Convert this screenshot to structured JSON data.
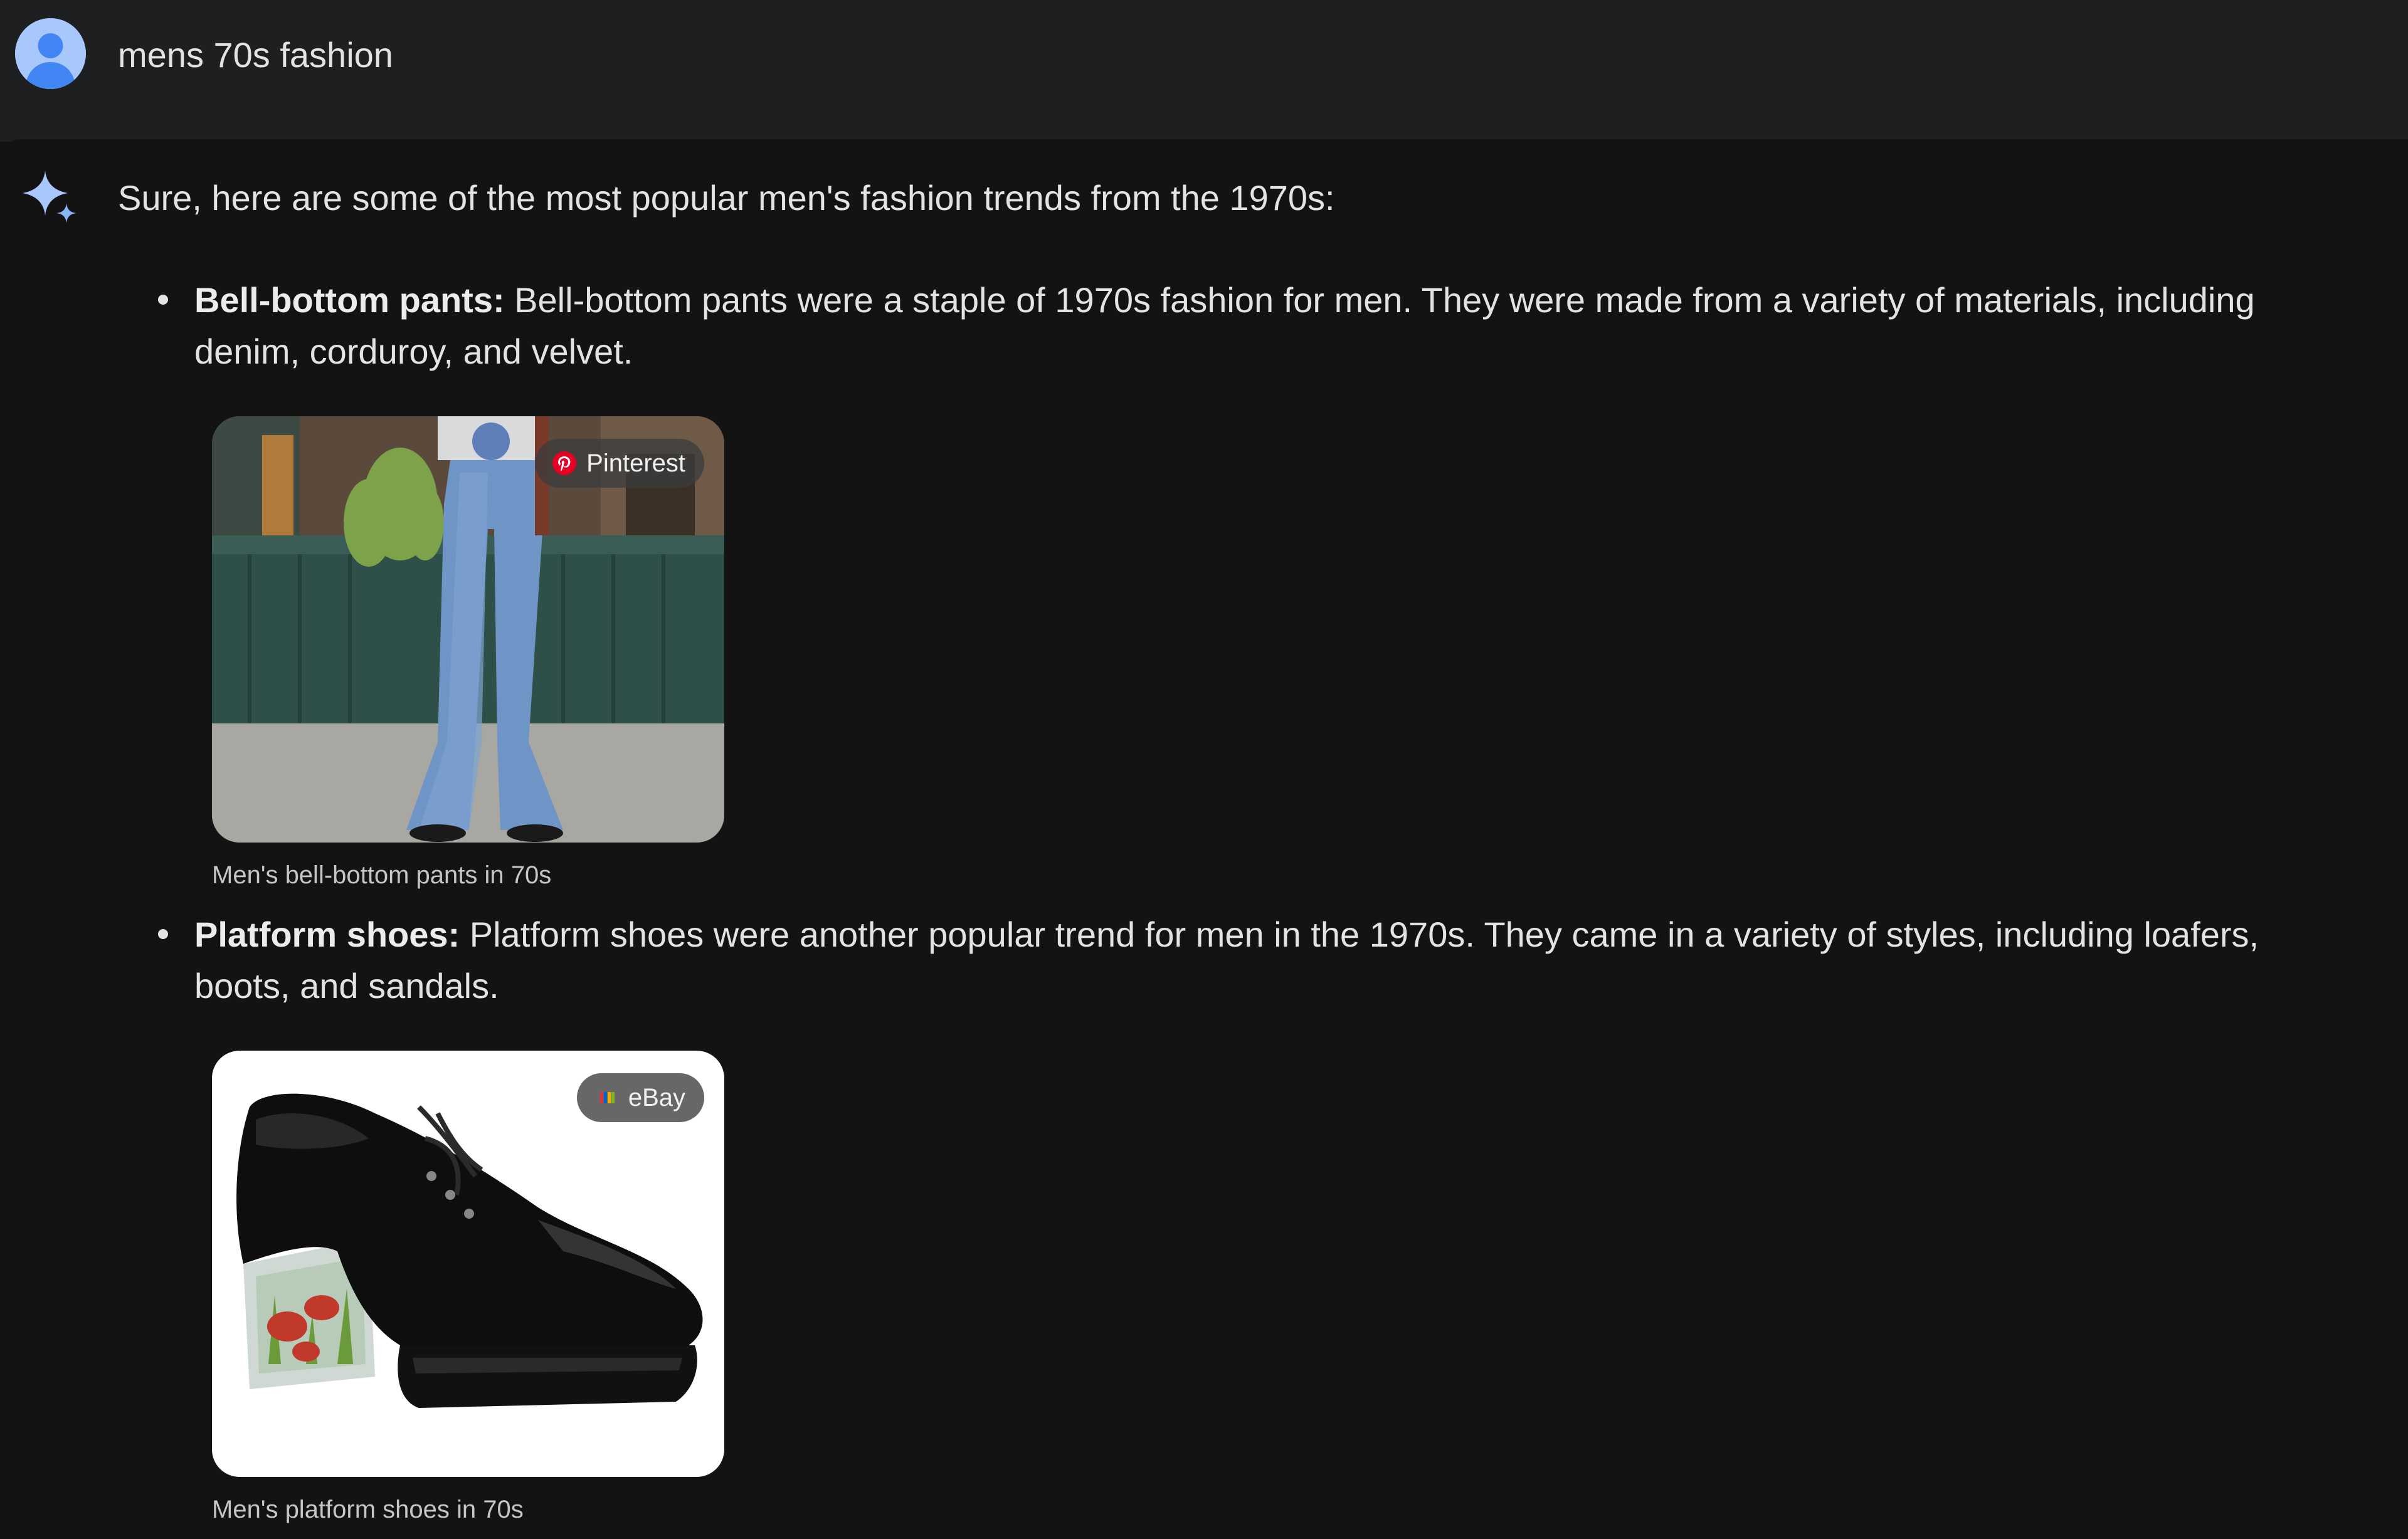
{
  "user": {
    "query": "mens 70s fashion"
  },
  "response": {
    "intro": "Sure, here are some of the most popular men's fashion trends from the 1970s:",
    "items": [
      {
        "title": "Bell-bottom pants:",
        "text": " Bell-bottom pants were a staple of 1970s fashion for men. They were made from a variety of materials, including denim, corduroy, and velvet.",
        "image_source": "Pinterest",
        "image_source_icon": "pinterest-icon",
        "caption": "Men's bell-bottom pants in 70s"
      },
      {
        "title": "Platform shoes:",
        "text": " Platform shoes were another popular trend for men in the 1970s. They came in a variety of styles, including loafers, boots, and sandals.",
        "image_source": "eBay",
        "image_source_icon": "ebay-icon",
        "caption": "Men's platform shoes in 70s"
      }
    ]
  },
  "colors": {
    "background": "#131314",
    "user_bar": "#1e1f20",
    "text": "#e3e3e3",
    "caption": "#c4c7c5",
    "avatar": "#a8c7fa",
    "spark": "#a8c7fa"
  }
}
